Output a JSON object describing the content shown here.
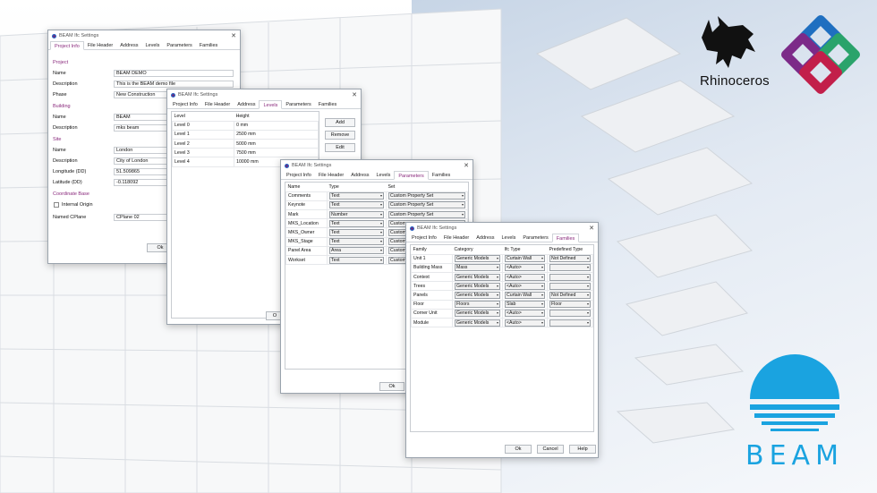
{
  "win1": {
    "title": "BEAM Ifc Settings",
    "tabs": [
      "Project Info",
      "File Header",
      "Address",
      "Levels",
      "Parameters",
      "Families"
    ],
    "project_section": "Project",
    "name_label": "Name",
    "name_value": "BEAM DEMO",
    "desc_label": "Description",
    "desc_value": "This is the BEAM demo file",
    "phase_label": "Phase",
    "phase_value": "New Construction",
    "building_section": "Building",
    "b_name_label": "Name",
    "b_name_value": "BEAM",
    "b_desc_label": "Description",
    "b_desc_value": "mks beam",
    "site_section": "Site",
    "s_name_label": "Name",
    "s_name_value": "London",
    "s_desc_label": "Description",
    "s_desc_value": "City of London",
    "lon_label": "Longitude (DD)",
    "lon_value": "51.509865",
    "lat_label": "Latitude (DD)",
    "lat_value": "-0.118092",
    "coord_section": "Coordinate Base",
    "internal_origin": "Internal Origin",
    "cplane_label": "Named CPlane",
    "cplane_value": "CPlane 02",
    "ok": "Ok"
  },
  "win2": {
    "title": "BEAM Ifc Settings",
    "tabs": [
      "Project Info",
      "File Header",
      "Address",
      "Levels",
      "Parameters",
      "Families"
    ],
    "headers": [
      "Level",
      "Height"
    ],
    "rows": [
      [
        "Level 0",
        "0 mm"
      ],
      [
        "Level 1",
        "2500 mm"
      ],
      [
        "Level 2",
        "5000 mm"
      ],
      [
        "Level 3",
        "7500 mm"
      ],
      [
        "Level 4",
        "10000 mm"
      ]
    ],
    "add": "Add",
    "remove": "Remove",
    "edit": "Edit",
    "ok": "O"
  },
  "win3": {
    "title": "BEAM Ifc Settings",
    "tabs": [
      "Project Info",
      "File Header",
      "Address",
      "Levels",
      "Parameters",
      "Families"
    ],
    "headers": [
      "Name",
      "Type",
      "Set"
    ],
    "rows": [
      [
        "Comments",
        "Text",
        "Custom Property Set"
      ],
      [
        "Keynote",
        "Text",
        "Custom Property Set"
      ],
      [
        "Mark",
        "Number",
        "Custom Property Set"
      ],
      [
        "MKS_Location",
        "Text",
        "Custom"
      ],
      [
        "MKS_Owner",
        "Text",
        "Custom"
      ],
      [
        "MKS_Stage",
        "Text",
        "Custom"
      ],
      [
        "Panel Area",
        "Area",
        "Custom"
      ],
      [
        "Workset",
        "Text",
        "Custom"
      ]
    ],
    "ok": "Ok"
  },
  "win4": {
    "title": "BEAM Ifc Settings",
    "tabs": [
      "Project Info",
      "File Header",
      "Address",
      "Levels",
      "Parameters",
      "Families"
    ],
    "headers": [
      "Family",
      "Category",
      "Ifc Type",
      "Predefined Type"
    ],
    "rows": [
      [
        "Unit 1",
        "Generic Models",
        "Curtain Wall",
        "Not Defined"
      ],
      [
        "Building Mass",
        "Mass",
        "<Auto>",
        ""
      ],
      [
        "Context",
        "Generic Models",
        "<Auto>",
        ""
      ],
      [
        "Trees",
        "Generic Models",
        "<Auto>",
        ""
      ],
      [
        "Panels",
        "Generic Models",
        "Curtain Wall",
        "Not Defined"
      ],
      [
        "Floor",
        "Floors",
        "Slab",
        "Floor"
      ],
      [
        "Corner Unit",
        "Generic Models",
        "<Auto>",
        ""
      ],
      [
        "Module",
        "Generic Models",
        "<Auto>",
        ""
      ]
    ],
    "ok": "Ok",
    "cancel": "Cancel",
    "help": "Help"
  },
  "logos": {
    "rhino": "Rhinoceros",
    "beam": "BEAM",
    "accent": "#8a2a7d",
    "beam_blue": "#1aa3e0"
  }
}
